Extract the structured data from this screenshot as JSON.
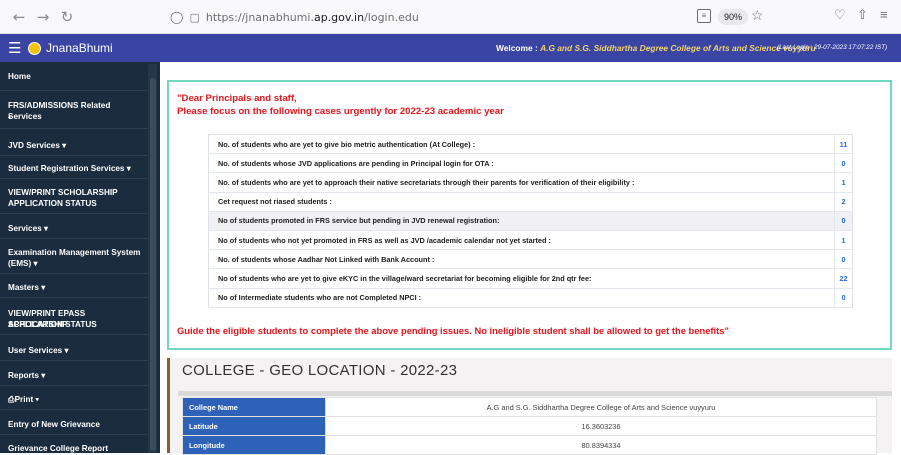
{
  "browser": {
    "url_prefix": "https://jnanabhumi.",
    "url_domain": "ap.gov.in",
    "url_path": "/login.edu",
    "zoom": "90%"
  },
  "header": {
    "app_title": "JnanaBhumi",
    "welcome_label": "Welcome : ",
    "welcome_name": "A.G and S.G. Siddhartha Degree College of Arts and Science vuyyuru",
    "last_login": "(Last Login : 29-07-2023 17:07:22 IST)"
  },
  "sidebar": {
    "items": [
      "Home",
      "FRS/ADMISSIONS Related Services",
      "•",
      "JVD Services ▾",
      "Student Registration Services ▾",
      "VIEW/PRINT SCHOLARSHIP",
      "APPLICATION STATUS",
      "Services ▾",
      "Examination Management System",
      "(EMS) ▾",
      "Masters ▾",
      "VIEW/PRINT EPASS SCHOLARSHIP",
      "APPLICATION STATUS",
      "User Services ▾",
      "Reports ▾",
      "Print ▾",
      "Entry of New Grievance",
      "Grievance College Report"
    ]
  },
  "notice": {
    "title_line1": "\"Dear Principals and staff,",
    "title_line2": "Please focus on the following cases urgently for 2022-23 academic year",
    "rows": [
      {
        "label": "No. of students who are yet to give bio metric authentication (At College) :",
        "value": "11"
      },
      {
        "label": "No. of students whose JVD applications are pending in Principal login for OTA :",
        "value": "0"
      },
      {
        "label": "No. of students who are yet to approach their native secretariats through their parents for verification of their eligibility :",
        "value": "1"
      },
      {
        "label": "Cet request not riased students :",
        "value": "2"
      },
      {
        "label": "No of students promoted in FRS service but pending in JVD renewal registration:",
        "value": "0"
      },
      {
        "label": "No of students who not yet promoted in FRS as well as JVD /academic calendar not yet started :",
        "value": "1"
      },
      {
        "label": "No. of students whose Aadhar Not Linked with Bank Account :",
        "value": "0"
      },
      {
        "label": "No of students who are yet to give eKYC in the village/ward secretariat for becoming eligible for 2nd qtr fee:",
        "value": "22"
      },
      {
        "label": "No of Intermediate students who are not Completed NPCI :",
        "value": "0"
      }
    ],
    "footer": "Guide the eligible students to complete the above pending issues. No ineligible student shall be allowed to get the benefits\""
  },
  "geo": {
    "title": "COLLEGE - GEO LOCATION - 2022-23",
    "rows": [
      {
        "key": "College Name",
        "value": "A.G and S.G. Siddhartha Degree College of Arts and Science vuyyuru"
      },
      {
        "key": "Latitude",
        "value": "16.3603236"
      },
      {
        "key": "Longitude",
        "value": "80.8394334"
      }
    ]
  }
}
